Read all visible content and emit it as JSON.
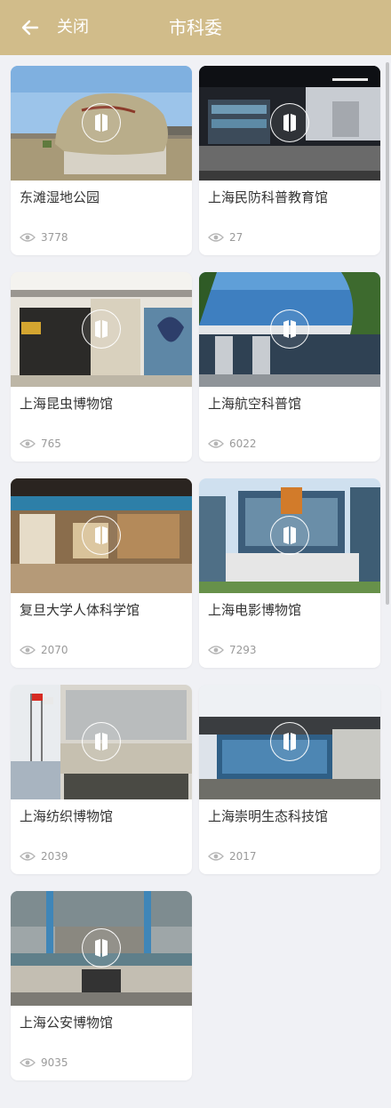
{
  "header": {
    "close_label": "关闭",
    "title": "市科委",
    "background": "#d1bc8a"
  },
  "items": [
    {
      "title": "东滩湿地公园",
      "views": "3778",
      "scene": "rock"
    },
    {
      "title": "上海民防科普教育馆",
      "views": "27",
      "scene": "exhibit-dark"
    },
    {
      "title": "上海昆虫博物馆",
      "views": "765",
      "scene": "entrance"
    },
    {
      "title": "上海航空科普馆",
      "views": "6022",
      "scene": "aviation"
    },
    {
      "title": "复旦大学人体科学馆",
      "views": "2070",
      "scene": "exhibit-light"
    },
    {
      "title": "上海电影博物馆",
      "views": "7293",
      "scene": "film"
    },
    {
      "title": "上海纺织博物馆",
      "views": "2039",
      "scene": "textile"
    },
    {
      "title": "上海崇明生态科技馆",
      "views": "2017",
      "scene": "eco"
    },
    {
      "title": "上海公安博物馆",
      "views": "9035",
      "scene": "police"
    }
  ]
}
